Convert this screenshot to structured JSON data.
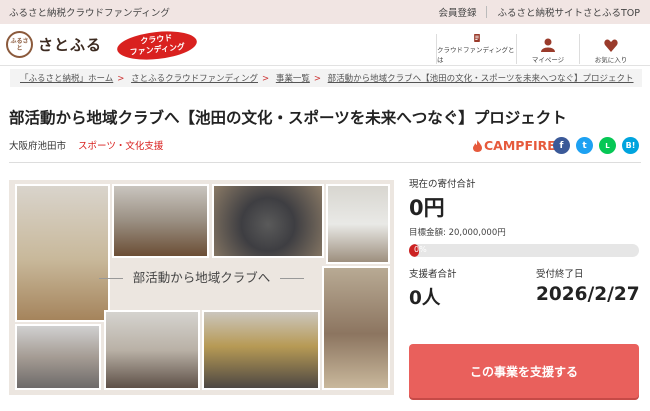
{
  "topbar": {
    "tagline": "ふるさと納税クラウドファンディング",
    "links": [
      "会員登録",
      "ふるさと納税サイトさとふるTOP"
    ]
  },
  "header": {
    "logo_text": "さとふる",
    "logo_mark_text": "ふるさと",
    "cf_badge_line1": "クラウド",
    "cf_badge_line2": "ファンディング",
    "nav": [
      {
        "label": "クラウドファンディングとは",
        "icon": "info-icon"
      },
      {
        "label": "マイページ",
        "icon": "person-icon"
      },
      {
        "label": "お気に入り",
        "icon": "heart-icon"
      }
    ]
  },
  "breadcrumb": [
    "「ふるさと納税」ホーム",
    "さとふるクラウドファンディング",
    "事業一覧",
    "部活動から地域クラブへ【池田の文化・スポーツを未来へつなぐ】プロジェクト"
  ],
  "project": {
    "title": "部活動から地域クラブへ【池田の文化・スポーツを未来へつなぐ】プロジェクト",
    "city": "大阪府池田市",
    "category": "スポーツ・文化支援",
    "platform": "CAMPFIRE",
    "hero_caption": "部活動から地域クラブへ"
  },
  "share": [
    {
      "name": "facebook",
      "glyph": "f",
      "color": "#3b5998"
    },
    {
      "name": "twitter",
      "glyph": "t",
      "color": "#1da1f2"
    },
    {
      "name": "line",
      "glyph": "L",
      "color": "#06c755"
    },
    {
      "name": "hatena",
      "glyph": "B!",
      "color": "#00a4de"
    }
  ],
  "stats": {
    "current_label": "現在の寄付合計",
    "current_amount": "0円",
    "goal_text": "目標金額: 20,000,000円",
    "progress_percent": 0,
    "progress_text": "0%",
    "supporters_label": "支援者合計",
    "supporters_value": "0人",
    "deadline_label": "受付終了日",
    "deadline_value": "2026/2/27",
    "support_button": "この事業を支援する"
  },
  "colors": {
    "accent": "#d9211f",
    "button": "#e9605c",
    "topbar": "#f1e5e3"
  }
}
